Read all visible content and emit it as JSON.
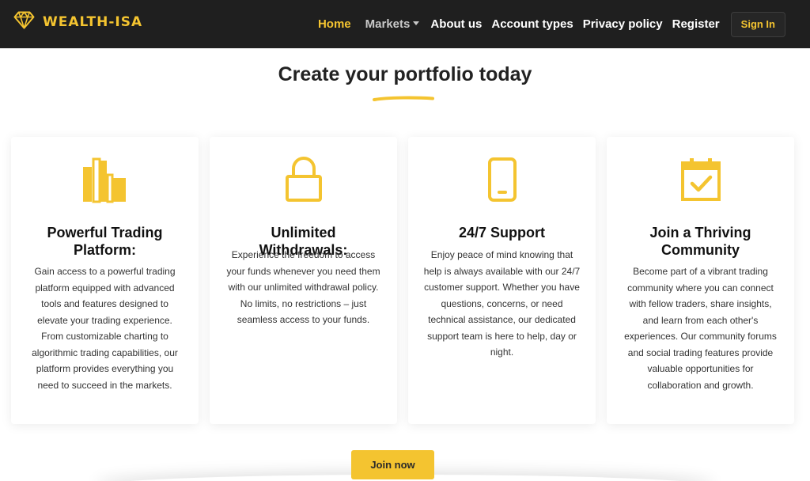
{
  "colors": {
    "accent": "#f4c430",
    "header_bg": "#1f1f1f"
  },
  "header": {
    "brand": {
      "name": "WEALTH-ISA",
      "logo_icon": "diamond-icon"
    },
    "nav": [
      {
        "label": "Home",
        "state": "active"
      },
      {
        "label": "Markets",
        "state": "dropdown"
      },
      {
        "label": "About us"
      },
      {
        "label": "Account types"
      },
      {
        "label": "Privacy policy"
      },
      {
        "label": "Register"
      }
    ],
    "signin_label": "Sign In"
  },
  "section": {
    "title": "Create your portfolio today"
  },
  "cards": [
    {
      "icon": "bar-chart-icon",
      "title": "Powerful Trading Platform:",
      "text": "Gain access to a powerful trading platform equipped with advanced tools and features designed to elevate your trading experience. From customizable charting to algorithmic trading capabilities, our platform provides everything you need to succeed in the markets."
    },
    {
      "icon": "lock-icon",
      "title": "Unlimited Withdrawals:",
      "text": "Experience the freedom to access your funds whenever you need them with our unlimited withdrawal policy. No limits, no restrictions – just seamless access to your funds."
    },
    {
      "icon": "mobile-phone-icon",
      "title": "24/7 Support",
      "text": "Enjoy peace of mind knowing that help is always available with our 24/7 customer support. Whether you have questions, concerns, or need technical assistance, our dedicated support team is here to help, day or night."
    },
    {
      "icon": "calendar-check-icon",
      "title": "Join a Thriving Community",
      "text": "Become part of a vibrant trading community where you can connect with fellow traders, share insights, and learn from each other's experiences. Our community forums and social trading features provide valuable opportunities for collaboration and growth."
    }
  ],
  "cta": {
    "join_label": "Join now"
  }
}
